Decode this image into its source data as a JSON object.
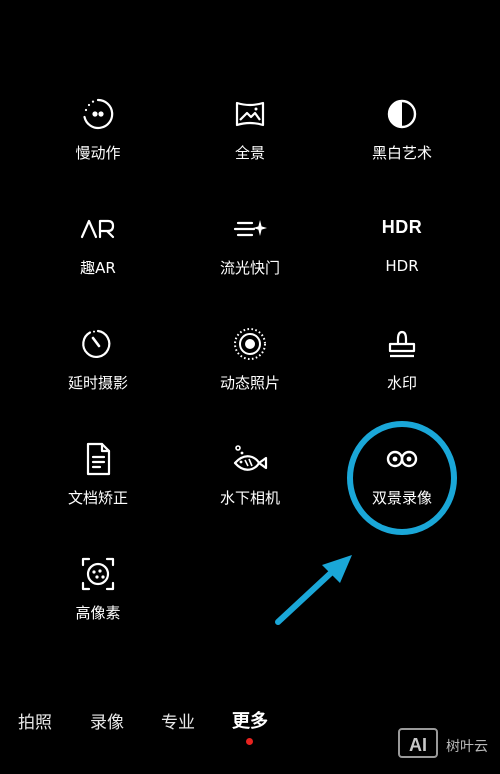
{
  "modes": {
    "slow_motion": {
      "label": "慢动作",
      "icon": "slow-motion-icon"
    },
    "panorama": {
      "label": "全景",
      "icon": "panorama-icon"
    },
    "monochrome": {
      "label": "黑白艺术",
      "icon": "half-circle-icon"
    },
    "ar_fun": {
      "label": "趣AR",
      "icon": "ar-icon"
    },
    "light_painting": {
      "label": "流光快门",
      "icon": "light-trail-icon"
    },
    "hdr": {
      "label": "HDR",
      "icon_text": "HDR",
      "icon": "hdr-icon"
    },
    "time_lapse": {
      "label": "延时摄影",
      "icon": "timer-icon"
    },
    "moving_picture": {
      "label": "动态照片",
      "icon": "moving-picture-icon"
    },
    "watermark": {
      "label": "水印",
      "icon": "stamp-icon"
    },
    "document_scan": {
      "label": "文档矫正",
      "icon": "document-icon"
    },
    "underwater": {
      "label": "水下相机",
      "icon": "fish-icon"
    },
    "dual_view": {
      "label": "双景录像",
      "icon": "dual-view-icon"
    },
    "high_res": {
      "label": "高像素",
      "icon": "high-res-icon"
    }
  },
  "tabs": {
    "photo": "拍照",
    "video": "录像",
    "pro": "专业",
    "more": "更多",
    "active": "more"
  },
  "annotation": {
    "color": "#1aa7d8",
    "target": "dual_view"
  },
  "watermark": {
    "logo": "AI",
    "text": "树叶云"
  },
  "colors": {
    "background": "#000000",
    "active_dot": "#e8231f"
  }
}
